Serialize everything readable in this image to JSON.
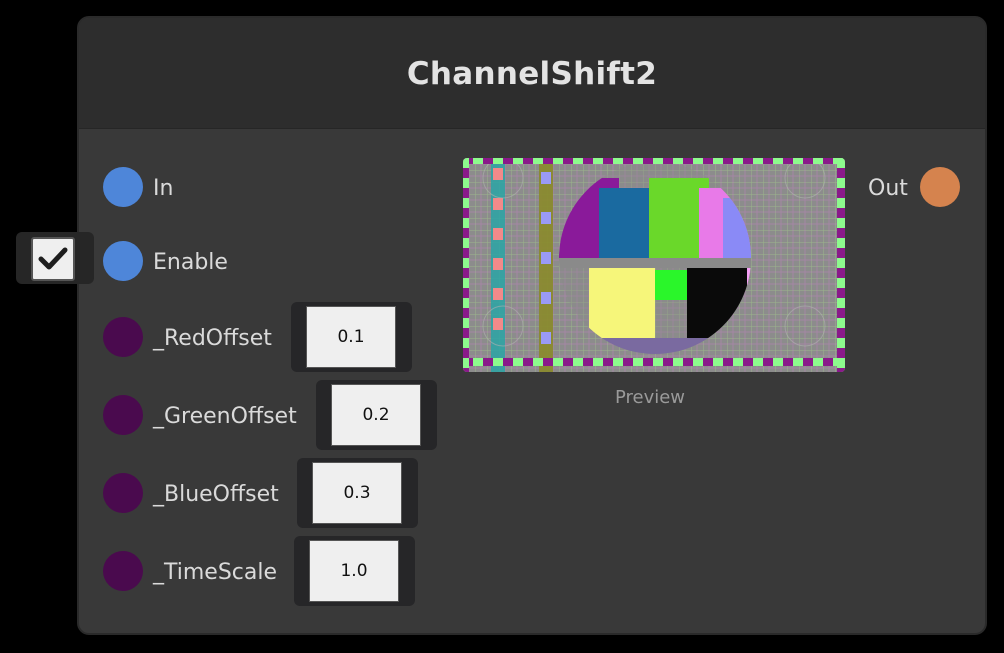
{
  "node": {
    "title": "ChannelShift2",
    "inputs": [
      {
        "label": "In",
        "color": "#4e86d9"
      },
      {
        "label": "Enable",
        "color": "#4e86d9",
        "checkbox_checked": true
      },
      {
        "label": "_RedOffset",
        "color": "#4a0a4e",
        "value": "0.1"
      },
      {
        "label": "_GreenOffset",
        "color": "#4a0a4e",
        "value": "0.2"
      },
      {
        "label": "_BlueOffset",
        "color": "#4a0a4e",
        "value": "0.3"
      },
      {
        "label": "_TimeScale",
        "color": "#4a0a4e",
        "value": "1.0"
      }
    ],
    "output": {
      "label": "Out",
      "color": "#d5834e"
    },
    "preview_label": "Preview",
    "icons": {
      "checkbox": "checkmark-icon"
    }
  }
}
